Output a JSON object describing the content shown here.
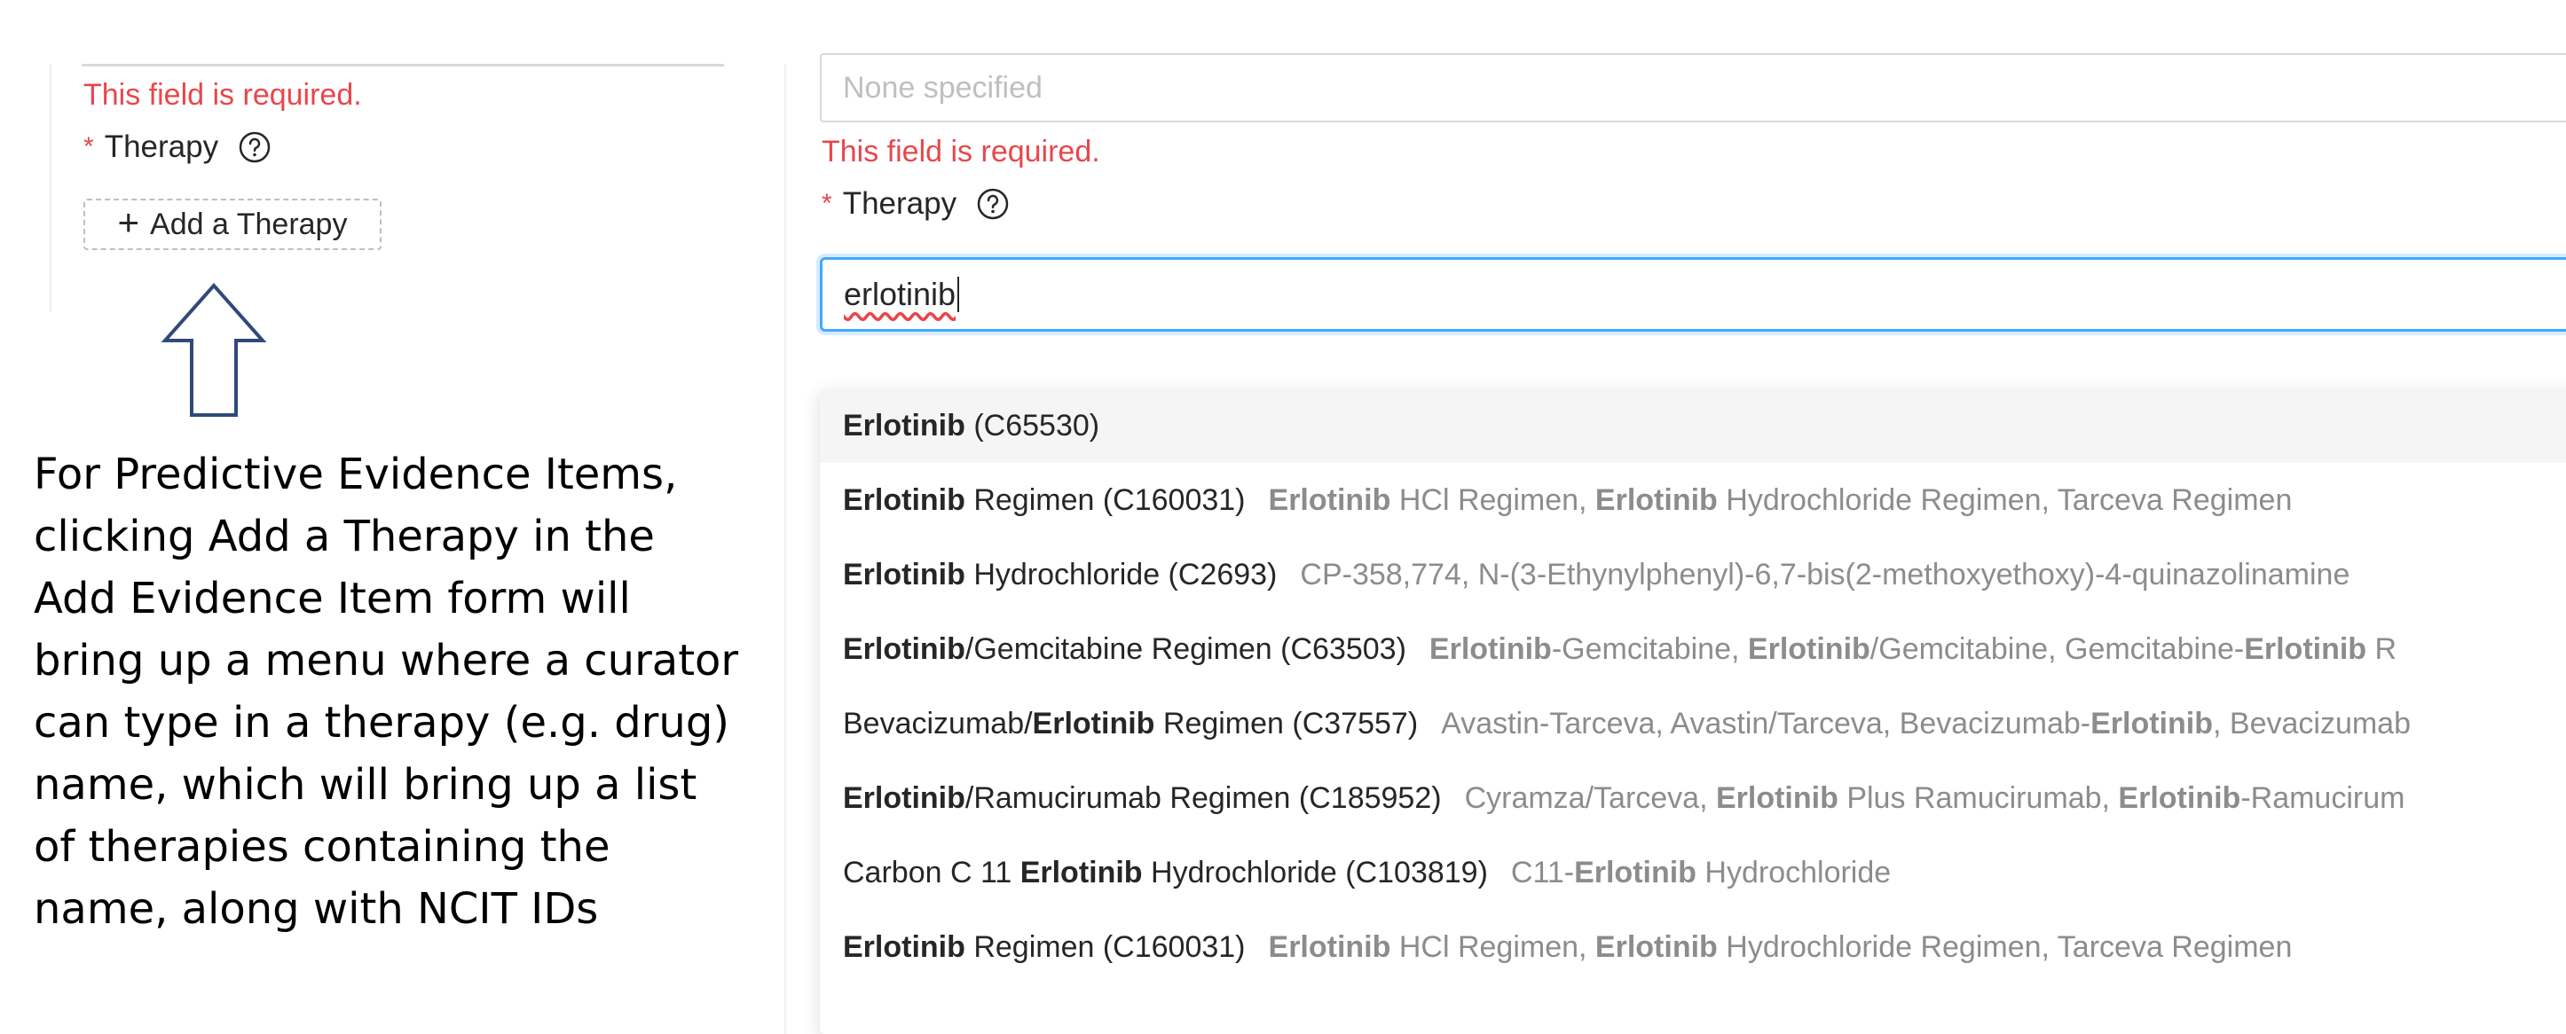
{
  "left": {
    "error_text": "This field is required.",
    "therapy_label": "Therapy",
    "required_mark": "*",
    "add_button_label": "Add a Therapy",
    "add_button_icon": "+",
    "annotation": "For Predictive Evidence Items, clicking Add a Therapy in the Add Evidence Item form will bring up a menu where a curator can type in a therapy (e.g. drug) name, which will bring up a list of therapies containing the name, along with NCIT IDs"
  },
  "right": {
    "none_placeholder": "None specified",
    "error_text": "This field is required.",
    "therapy_label": "Therapy",
    "required_mark": "*",
    "search_value": "erlotinib",
    "options": [
      {
        "parts": [
          [
            "Erlotinib",
            true
          ],
          [
            " (C65530)",
            false
          ]
        ],
        "synonyms": []
      },
      {
        "parts": [
          [
            "Erlotinib",
            true
          ],
          [
            " Regimen (C160031)",
            false
          ]
        ],
        "synonyms": [
          [
            "Erlotinib",
            true
          ],
          [
            " HCl Regimen, ",
            false
          ],
          [
            "Erlotinib",
            true
          ],
          [
            " Hydrochloride Regimen, Tarceva Regimen",
            false
          ]
        ]
      },
      {
        "parts": [
          [
            "Erlotinib",
            true
          ],
          [
            " Hydrochloride (C2693)",
            false
          ]
        ],
        "synonyms": [
          [
            "CP-358,774, N-(3-Ethynylphenyl)-6,7-bis(2-methoxyethoxy)-4-quinazolinamine",
            false
          ]
        ]
      },
      {
        "parts": [
          [
            "Erlotinib",
            true
          ],
          [
            "/Gemcitabine Regimen (C63503)",
            false
          ]
        ],
        "synonyms": [
          [
            "Erlotinib",
            true
          ],
          [
            "-Gemcitabine, ",
            false
          ],
          [
            "Erlotinib",
            true
          ],
          [
            "/Gemcitabine, Gemcitabine-",
            false
          ],
          [
            "Erlotinib",
            true
          ],
          [
            " R",
            false
          ]
        ]
      },
      {
        "parts": [
          [
            "Bevacizumab/",
            false
          ],
          [
            "Erlotinib",
            true
          ],
          [
            " Regimen (C37557)",
            false
          ]
        ],
        "synonyms": [
          [
            "Avastin-Tarceva, Avastin/Tarceva, Bevacizumab-",
            false
          ],
          [
            "Erlotinib",
            true
          ],
          [
            ", Bevacizumab",
            false
          ]
        ]
      },
      {
        "parts": [
          [
            "Erlotinib",
            true
          ],
          [
            "/Ramucirumab Regimen (C185952)",
            false
          ]
        ],
        "synonyms": [
          [
            "Cyramza/Tarceva, ",
            false
          ],
          [
            "Erlotinib",
            true
          ],
          [
            " Plus Ramucirumab, ",
            false
          ],
          [
            "Erlotinib",
            true
          ],
          [
            "-Ramucirum",
            false
          ]
        ]
      },
      {
        "parts": [
          [
            "Carbon C 11 ",
            false
          ],
          [
            "Erlotinib",
            true
          ],
          [
            " Hydrochloride (C103819)",
            false
          ]
        ],
        "synonyms": [
          [
            "C11-",
            false
          ],
          [
            "Erlotinib",
            true
          ],
          [
            " Hydrochloride",
            false
          ]
        ]
      },
      {
        "parts": [
          [
            "Erlotinib",
            true
          ],
          [
            " Regimen (C160031)",
            false
          ]
        ],
        "synonyms": [
          [
            "Erlotinib",
            true
          ],
          [
            " HCl Regimen, ",
            false
          ],
          [
            "Erlotinib",
            true
          ],
          [
            " Hydrochloride Regimen, Tarceva Regimen",
            false
          ]
        ]
      }
    ]
  },
  "colors": {
    "error": "#e8474b",
    "focus_border": "#40a9ff",
    "arrow": "#2f4a7a"
  }
}
